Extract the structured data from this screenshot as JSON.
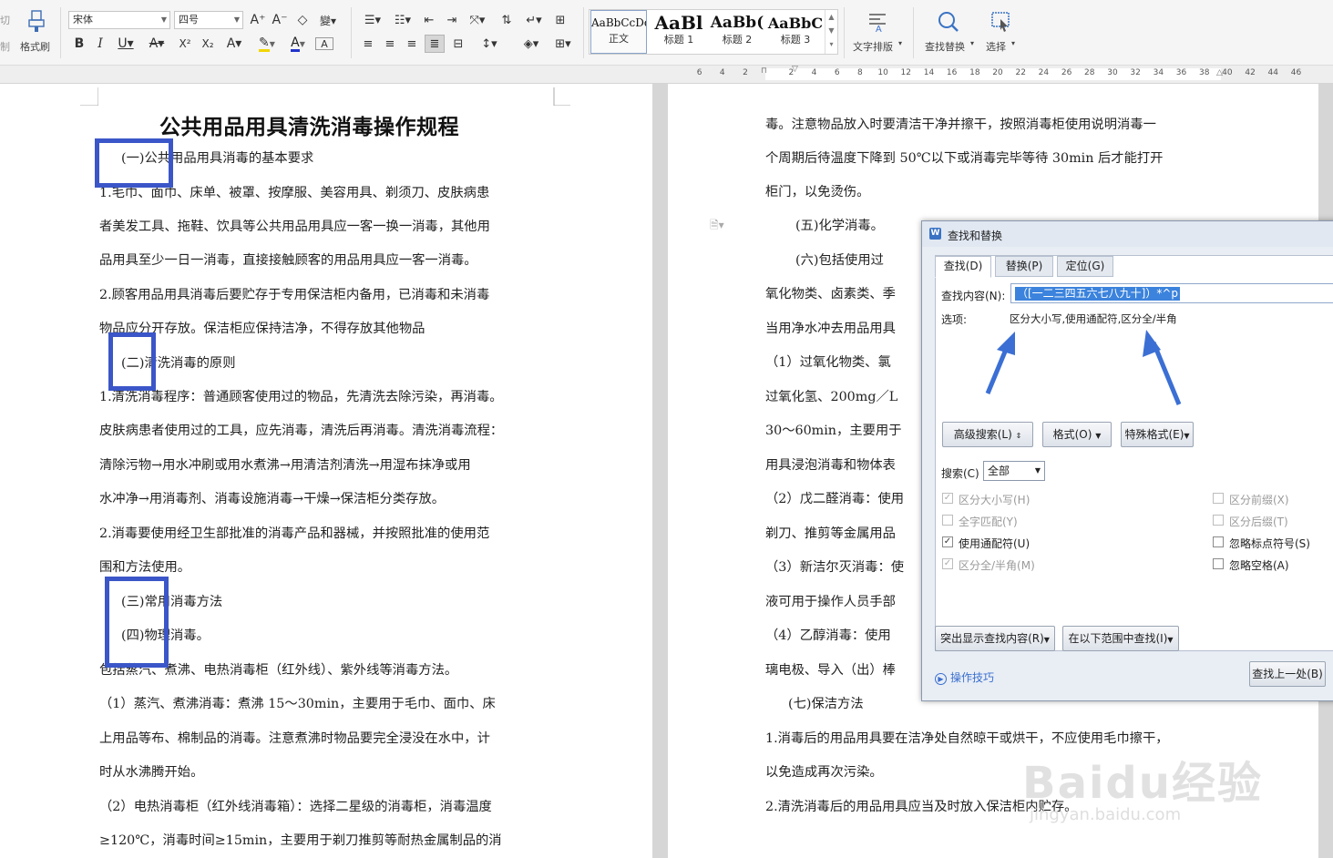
{
  "ribbon": {
    "cut_label": "切",
    "copy_label": "制",
    "format_painter_label": "格式刷",
    "font_name": "宋体",
    "font_size": "四号",
    "styles": [
      {
        "preview": "AaBbCcDd",
        "name": "正文"
      },
      {
        "preview": "AaBl",
        "name": "标题 1"
      },
      {
        "preview": "AaBb(",
        "name": "标题 2"
      },
      {
        "preview": "AaBbC",
        "name": "标题 3"
      }
    ],
    "text_layout_label": "文字排版",
    "find_replace_label": "查找替换",
    "select_label": "选择"
  },
  "ruler": {
    "ticks": [
      "6",
      "4",
      "2",
      "",
      "2",
      "4",
      "6",
      "8",
      "10",
      "12",
      "14",
      "16",
      "18",
      "20",
      "22",
      "24",
      "26",
      "28",
      "30",
      "32",
      "34",
      "36",
      "38",
      "40",
      "42",
      "44",
      "46"
    ]
  },
  "page1": {
    "title": "公共用品用具清洗消毒操作规程",
    "lines": [
      "(一)公共用品用具消毒的基本要求",
      "1.毛巾、面巾、床单、被罩、按摩服、美容用具、剃须刀、皮肤病患",
      "者美发工具、拖鞋、饮具等公共用品用具应一客一换一消毒，其他用",
      "品用具至少一日一消毒，直接接触顾客的用品用具应一客一消毒。",
      "2.顾客用品用具消毒后要贮存于专用保洁柜内备用，已消毒和未消毒",
      "物品应分开存放。保洁柜应保持洁净，不得存放其他物品",
      "(二)清洗消毒的原则",
      "1.清洗消毒程序：普通顾客使用过的物品，先清洗去除污染，再消毒。",
      "皮肤病患者使用过的工具，应先消毒，清洗后再消毒。清洗消毒流程：",
      "清除污物→用水冲刷或用水煮沸→用清洁剂清洗→用湿布抹净或用",
      "水冲净→用消毒剂、消毒设施消毒→干燥→保洁柜分类存放。",
      "2.消毒要使用经卫生部批准的消毒产品和器械，并按照批准的使用范",
      "围和方法使用。",
      "(三)常用消毒方法",
      "(四)物理消毒。",
      "包括蒸汽、煮沸、电热消毒柜（红外线）、紫外线等消毒方法。",
      "（1）蒸汽、煮沸消毒：煮沸 15～30min，主要用于毛巾、面巾、床",
      "上用品等布、棉制品的消毒。注意煮沸时物品要完全浸没在水中，计",
      "时从水沸腾开始。",
      "（2）电热消毒柜（红外线消毒箱）：选择二星级的消毒柜，消毒温度",
      "≥120℃，消毒时间≥15min，主要用于剃刀推剪等耐热金属制品的消"
    ]
  },
  "page2": {
    "lines": [
      "毒。注意物品放入时要清洁干净并擦干，按照消毒柜使用说明消毒一",
      "个周期后待温度下降到 50℃以下或消毒完毕等待 30min 后才能打开",
      "柜门，以免烫伤。",
      "(五)化学消毒。",
      "(六)包括使用过",
      "氧化物类、卤素类、季",
      "当用净水冲去用品用具",
      "（1）过氧化物类、氯",
      "过氧化氢、200mg／L ",
      "30～60min，主要用于",
      "用具浸泡消毒和物体表",
      "（2）戊二醛消毒：使用",
      "剃刀、推剪等金属用品",
      "（3）新洁尔灭消毒：使",
      "液可用于操作人员手部",
      "（4）乙醇消毒：使用",
      "璃电极、导入（出）棒",
      "(七)保洁方法",
      "1.消毒后的用品用具要在洁净处自然晾干或烘干，不应使用毛巾擦干，",
      "以免造成再次污染。",
      "2.清洗消毒后的用品用具应当及时放入保洁柜内贮存。"
    ]
  },
  "dialog": {
    "title": "查找和替换",
    "tabs": [
      "查找(D)",
      "替换(P)",
      "定位(G)"
    ],
    "find_label": "查找内容(N):",
    "find_value": "（[一二三四五六七八九十]）*^p",
    "options_label": "选项:",
    "options_value": "区分大小写,使用通配符,区分全/半角",
    "btn_advanced": "高级搜索(L)",
    "btn_format": "格式(O)",
    "btn_special": "特殊格式(E)",
    "search_label": "搜索(C)",
    "search_value": "全部",
    "checks_left": [
      {
        "label": "区分大小写(H)",
        "checked": true,
        "disabled": true
      },
      {
        "label": "全字匹配(Y)",
        "checked": false,
        "disabled": true
      },
      {
        "label": "使用通配符(U)",
        "checked": true,
        "disabled": false
      },
      {
        "label": "区分全/半角(M)",
        "checked": true,
        "disabled": true
      }
    ],
    "checks_right": [
      {
        "label": "区分前缀(X)",
        "checked": false,
        "disabled": true
      },
      {
        "label": "区分后缀(T)",
        "checked": false,
        "disabled": true
      },
      {
        "label": "忽略标点符号(S)",
        "checked": false,
        "disabled": false
      },
      {
        "label": "忽略空格(A)",
        "checked": false,
        "disabled": false
      }
    ],
    "btn_highlight": "突出显示查找内容(R)",
    "btn_find_in": "在以下范围中查找(I)",
    "tips_label": "操作技巧",
    "btn_find_prev": "查找上一处(B)"
  },
  "watermark": {
    "main": "Baidu经验",
    "sub": "jingyan.baidu.com"
  },
  "colors": {
    "highlight_box": "#3b56c8",
    "arrow": "#3b6fd4",
    "selection": "#3b83dd"
  }
}
